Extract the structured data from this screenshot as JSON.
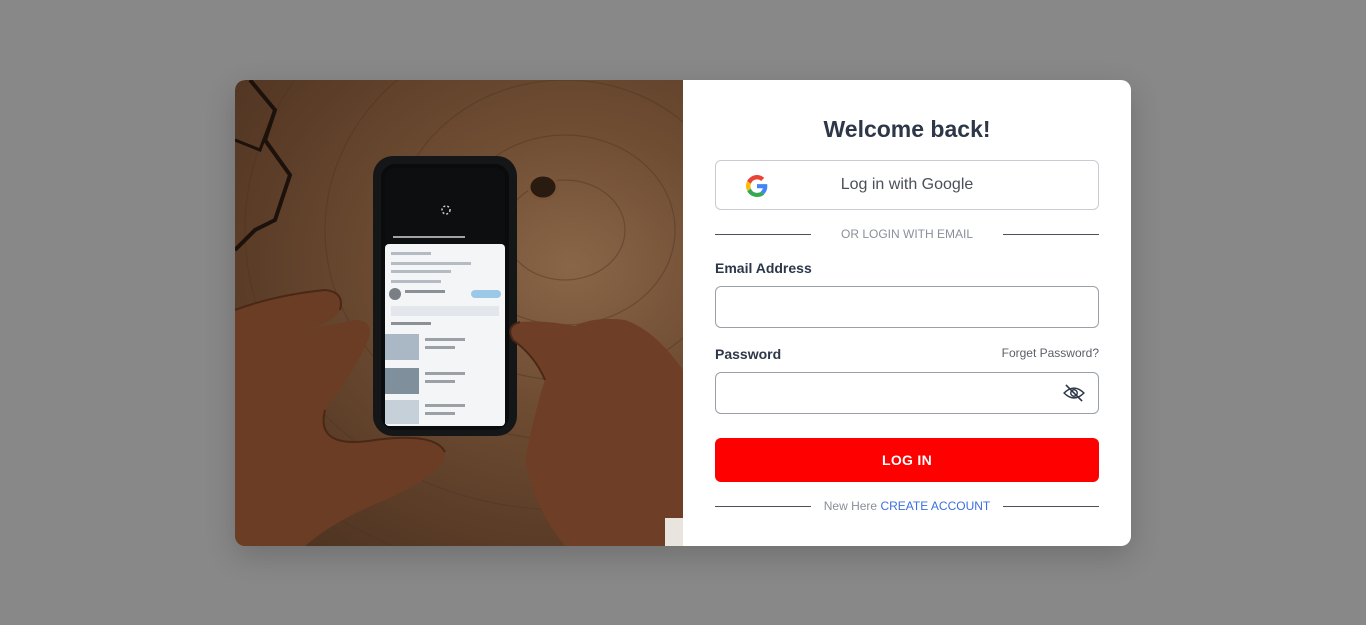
{
  "photo": {
    "description_icon": "phone-on-wood-photo-icon",
    "colors": {
      "wood": "#6f4d33",
      "phone": "#141618"
    }
  },
  "form": {
    "title": "Welcome back!",
    "google_button": {
      "label": "Log in with Google",
      "icon": "google-icon"
    },
    "divider_email": "OR LOGIN WITH EMAIL",
    "email": {
      "label": "Email Address",
      "value": "",
      "placeholder": ""
    },
    "password": {
      "label": "Password",
      "value": "",
      "placeholder": "",
      "forgot": "Forget Password?",
      "toggle_icon": "eye-slash-icon"
    },
    "login_button": "LOG IN",
    "signup": {
      "prefix": "New Here",
      "link": "CREATE ACCOUNT"
    }
  },
  "colors": {
    "background": "#888888",
    "primary": "#ff0000",
    "link": "#3b6fe0",
    "title": "#2d3748"
  }
}
